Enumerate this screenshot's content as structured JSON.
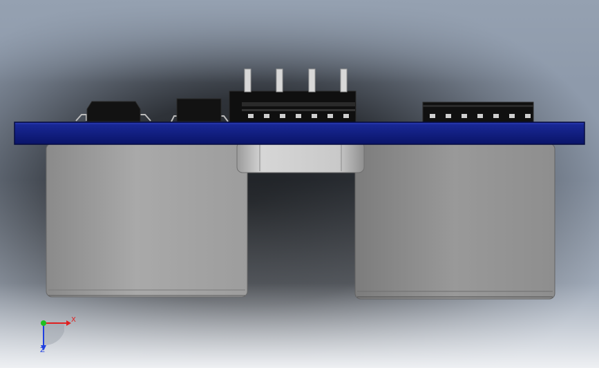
{
  "viewport": {
    "background_top": "#8f9bab",
    "background_mid": "#2c2f34",
    "background_bottom": "#e9ecf0"
  },
  "model": {
    "pcb_color": "#0c1a7a",
    "transducer_color": "#9a9a9a",
    "crystal_color": "#bdbdbd",
    "chip_color": "#111111",
    "pin_color": "#d7d7d7"
  },
  "triad": {
    "x_label": "X",
    "z_label": "Z",
    "x_color": "#e02020",
    "y_color": "#20c020",
    "z_color": "#2040e0"
  }
}
